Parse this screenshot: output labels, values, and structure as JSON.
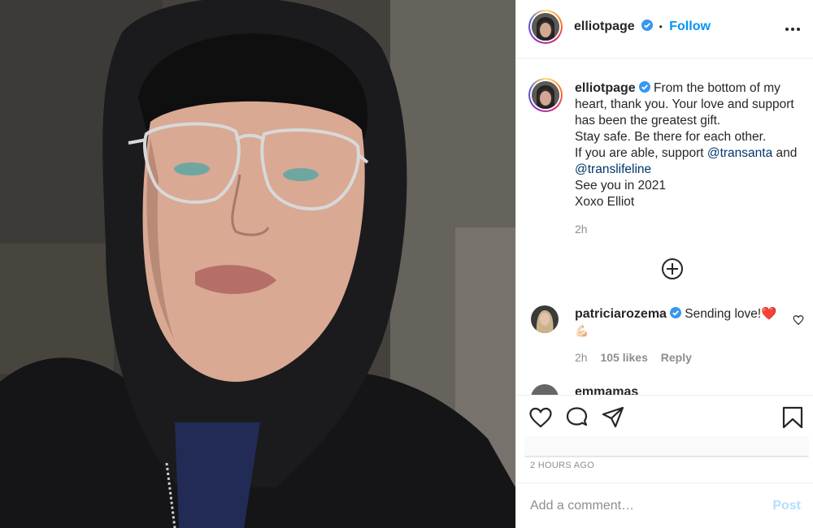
{
  "post": {
    "photo_description_icon": "portrait-photo"
  },
  "header": {
    "username": "elliotpage",
    "separator": "•",
    "follow_label": "Follow",
    "more_icon": "more-horizontal-icon"
  },
  "caption": {
    "username": "elliotpage",
    "lines": [
      {
        "before": "From the bottom of my"
      },
      {
        "before": "heart, thank you. Your love and support"
      },
      {
        "before": "has been the greatest gift."
      },
      {
        "before": "Stay safe. Be there for each other."
      },
      {
        "before": "If you are able, support ",
        "mention": "@transanta",
        "after": " and"
      },
      {
        "mention": "@translifeline"
      },
      {
        "before": "See you in 2021"
      },
      {
        "before": "Xoxo Elliot"
      }
    ],
    "first_line": "From the bottom of my",
    "line2": "heart, thank you. Your love and support",
    "line3": "has been the greatest gift.",
    "line4": "Stay safe. Be there for each other.",
    "line5_before": "If you are able, support ",
    "line5_mention": "@transanta",
    "line5_after": " and",
    "line6_mention": "@translifeline",
    "line7": "See you in 2021",
    "line8": "Xoxo Elliot",
    "time": "2h"
  },
  "comments": [
    {
      "username": "patriciarozema",
      "text": "Sending love!",
      "emoji": "❤️",
      "emoji_line2": "💪🏻",
      "time": "2h",
      "likes": "105 likes",
      "reply_label": "Reply"
    },
    {
      "username": "emmamas"
    }
  ],
  "actions": {
    "like_icon": "heart-icon",
    "comment_icon": "comment-bubble-icon",
    "share_icon": "paper-plane-icon",
    "save_icon": "bookmark-icon"
  },
  "timestamp": "2 HOURS AGO",
  "comment_box": {
    "placeholder": "Add a comment…",
    "post_label": "Post"
  },
  "colors": {
    "accent": "#0095f6",
    "verified": "#3897f0",
    "mention": "#00376b",
    "muted": "#8e8e8e",
    "post_disabled": "#b2dffc"
  }
}
